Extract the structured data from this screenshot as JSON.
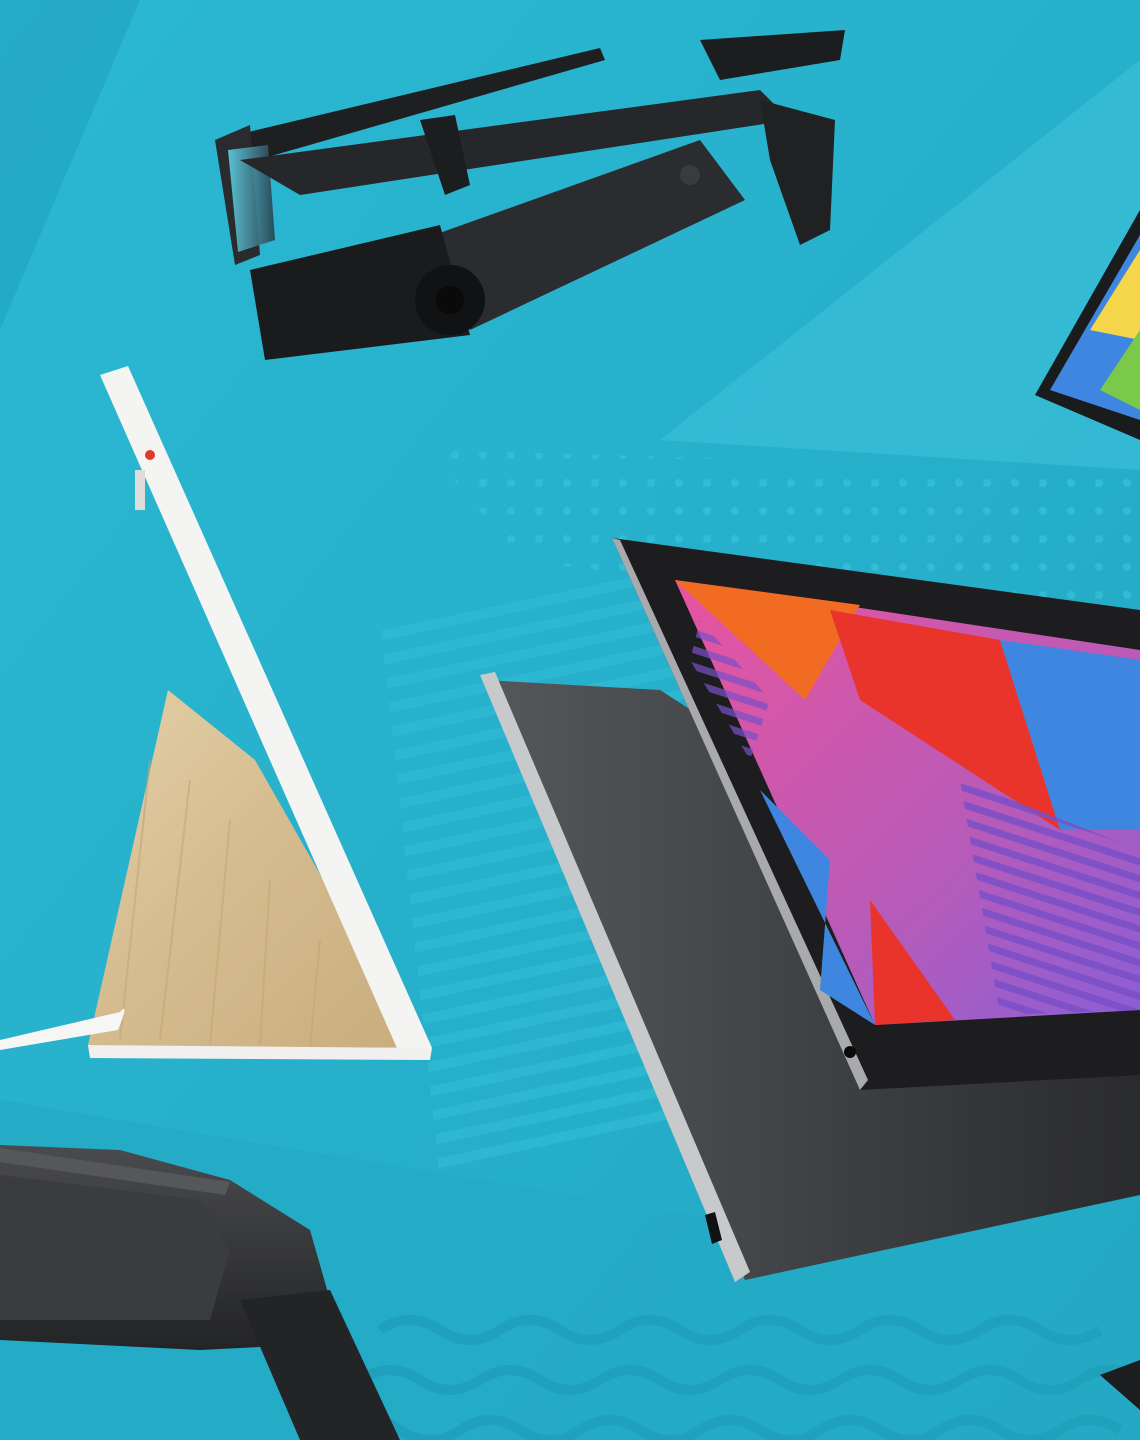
{
  "scene": {
    "subjects": [
      "ar-smart-glasses-icon",
      "smart-display-icon",
      "tablet-pair-icon",
      "laptop-corner-icon",
      "vr-headset-icon"
    ],
    "colors": {
      "background": "#27b3cd",
      "background_light": "#3cc2da",
      "background_dark": "#1fa1bd",
      "device_black": "#1d1d1f",
      "device_gray": "#3a3b3e",
      "wood": "#d8c39a",
      "white_plastic": "#f4f4f2",
      "screen_pink": "#e0509e",
      "screen_red": "#e8342a",
      "screen_orange": "#f26b23",
      "screen_blue": "#3f86e0",
      "screen_purple": "#8b5fd6"
    }
  }
}
